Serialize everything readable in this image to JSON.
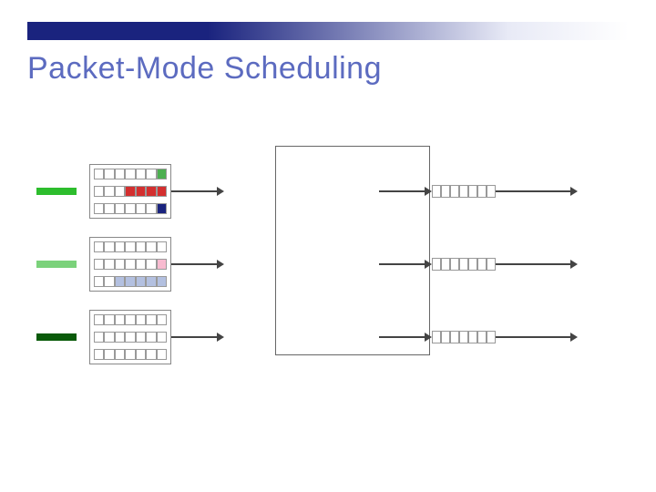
{
  "title": "Packet-Mode Scheduling",
  "colors": {
    "mark1": "#2dbd2d",
    "mark2": "#7bd27b",
    "mark3": "#0a5a0a",
    "red": "#d32f2f",
    "lightred": "#f8bbd0",
    "green": "#4caf50",
    "darkblue": "#1a237e",
    "lightblue": "#b3c0e0"
  },
  "inputs": [
    {
      "mark_color_key": "mark1",
      "voq": [
        [
          "",
          "",
          "",
          "",
          "",
          "",
          "g"
        ],
        [
          "",
          "",
          "",
          "r",
          "r",
          "r",
          "r"
        ],
        [
          "",
          "",
          "",
          "",
          "",
          "",
          "db"
        ]
      ]
    },
    {
      "mark_color_key": "mark2",
      "voq": [
        [
          "",
          "",
          "",
          "",
          "",
          "",
          ""
        ],
        [
          "",
          "",
          "",
          "",
          "",
          "",
          "lr"
        ],
        [
          "",
          "",
          "lb",
          "lb",
          "lb",
          "lb",
          "lb"
        ]
      ]
    },
    {
      "mark_color_key": "mark3",
      "voq": [
        [
          "",
          "",
          "",
          "",
          "",
          "",
          ""
        ],
        [
          "",
          "",
          "",
          "",
          "",
          "",
          ""
        ],
        [
          "",
          "",
          "",
          "",
          "",
          "",
          ""
        ]
      ]
    }
  ],
  "outputs": [
    {
      "cells": [
        "",
        "",
        "",
        "",
        "",
        "",
        ""
      ]
    },
    {
      "cells": [
        "",
        "",
        "",
        "",
        "",
        "",
        ""
      ]
    },
    {
      "cells": [
        "",
        "",
        "",
        "",
        "",
        "",
        ""
      ]
    }
  ]
}
